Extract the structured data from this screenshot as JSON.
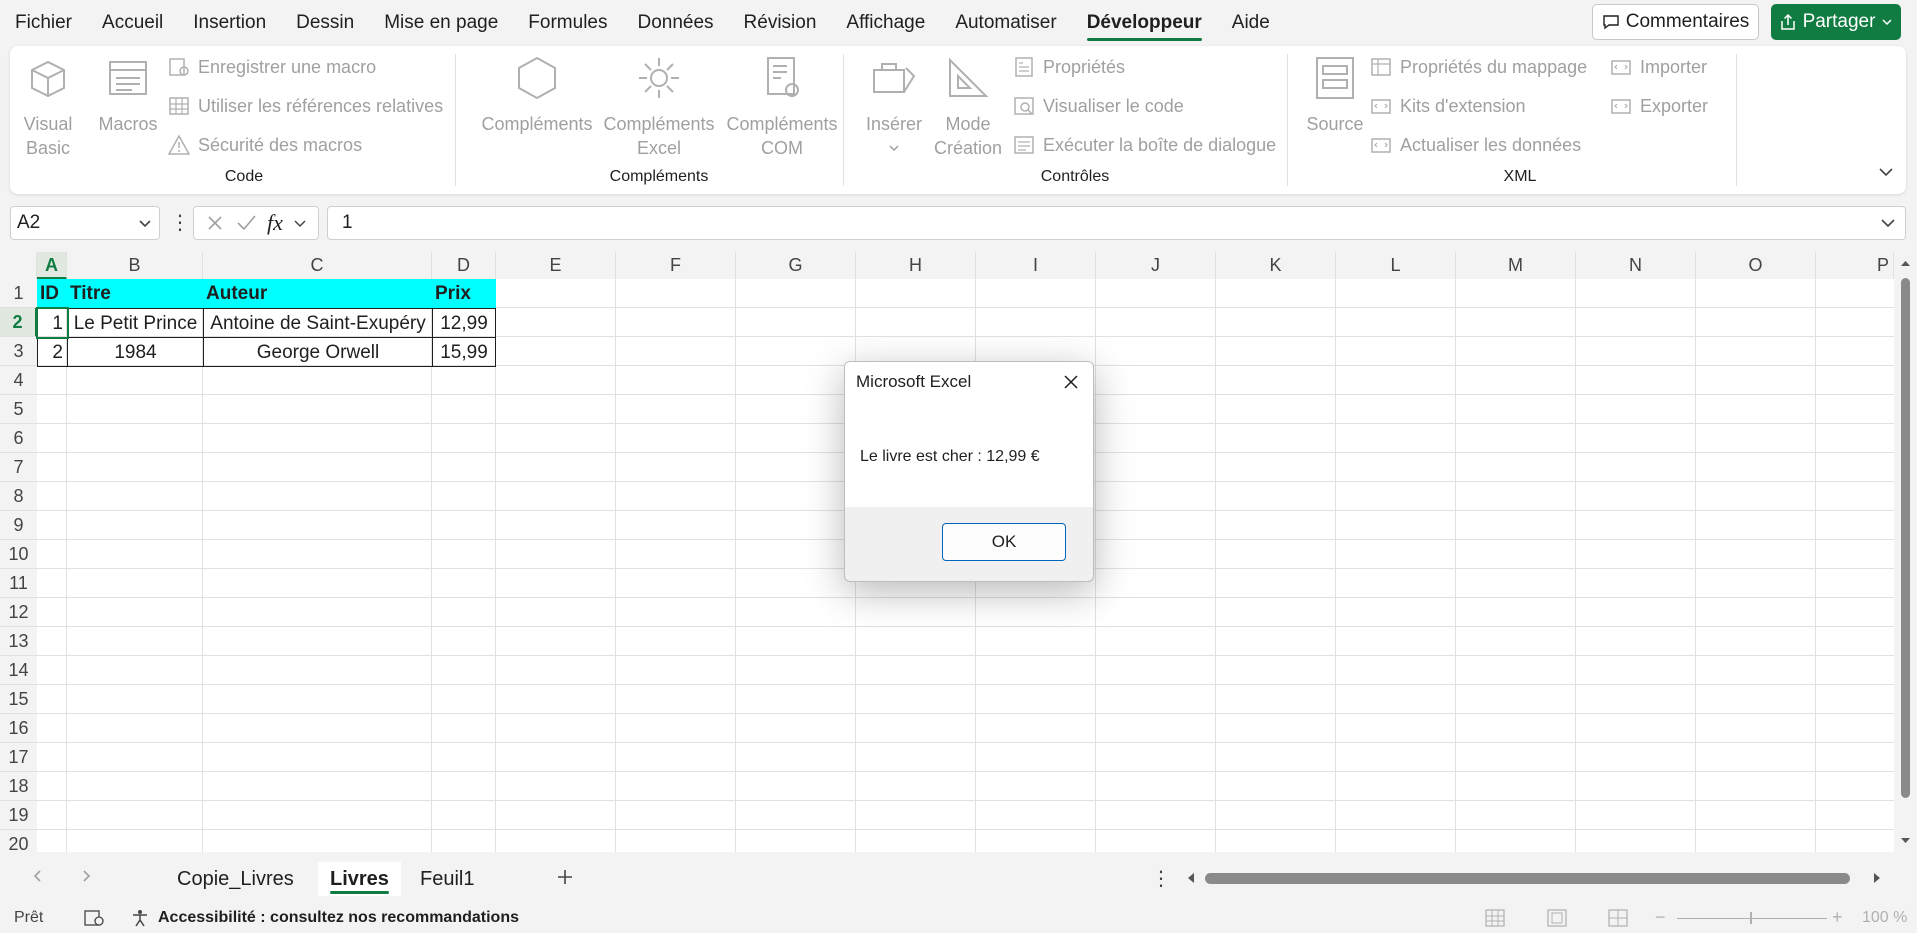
{
  "menu": {
    "items": [
      "Fichier",
      "Accueil",
      "Insertion",
      "Dessin",
      "Mise en page",
      "Formules",
      "Données",
      "Révision",
      "Affichage",
      "Automatiser",
      "Développeur",
      "Aide"
    ],
    "active": "Développeur",
    "comments_label": "Commentaires",
    "share_label": "Partager"
  },
  "ribbon": {
    "code": {
      "label": "Code",
      "visual_basic": "Visual Basic",
      "visual_basic_l1": "Visual",
      "visual_basic_l2": "Basic",
      "macros": "Macros",
      "record_macro": "Enregistrer une macro",
      "relative_refs": "Utiliser les références relatives",
      "macro_security": "Sécurité des macros"
    },
    "addins": {
      "label": "Compléments",
      "addins": "Compléments",
      "excel_addins_l1": "Compléments",
      "excel_addins_l2": "Excel",
      "com_addins_l1": "Compléments",
      "com_addins_l2": "COM"
    },
    "controls": {
      "label": "Contrôles",
      "insert": "Insérer",
      "design_l1": "Mode",
      "design_l2": "Création",
      "properties": "Propriétés",
      "view_code": "Visualiser le code",
      "run_dialog": "Exécuter la boîte de dialogue"
    },
    "xml": {
      "label": "XML",
      "source": "Source",
      "map_properties": "Propriétés du mappage",
      "expansion_packs": "Kits d'extension",
      "refresh_data": "Actualiser les données",
      "import": "Importer",
      "export": "Exporter"
    }
  },
  "formula_bar": {
    "name_box": "A2",
    "fx": "fx",
    "value": "1"
  },
  "grid": {
    "columns": [
      "A",
      "B",
      "C",
      "D",
      "E",
      "F",
      "G",
      "H",
      "I",
      "J",
      "K",
      "L",
      "M",
      "N",
      "O",
      "P"
    ],
    "rows": [
      "1",
      "2",
      "3",
      "4",
      "5",
      "6",
      "7",
      "8",
      "9",
      "10",
      "11",
      "12",
      "13",
      "14",
      "15",
      "16",
      "17",
      "18",
      "19",
      "20"
    ],
    "header": [
      "ID",
      "Titre",
      "Auteur",
      "Prix"
    ],
    "data": [
      [
        "1",
        "Le Petit Prince",
        "Antoine de Saint-Exupéry",
        "12,99"
      ],
      [
        "2",
        "1984",
        "George Orwell",
        "15,99"
      ]
    ],
    "header_fill": "#00ffff"
  },
  "dialog": {
    "title": "Microsoft Excel",
    "message": "Le livre est cher : 12,99 €",
    "ok": "OK"
  },
  "sheets": {
    "tabs": [
      "Copie_Livres",
      "Livres",
      "Feuil1"
    ],
    "active": "Livres"
  },
  "status": {
    "ready": "Prêt",
    "accessibility": "Accessibilité : consultez nos recommandations",
    "zoom": "100 %"
  },
  "colors": {
    "accent": "#107c41",
    "dialog_button_border": "#0067c0"
  }
}
